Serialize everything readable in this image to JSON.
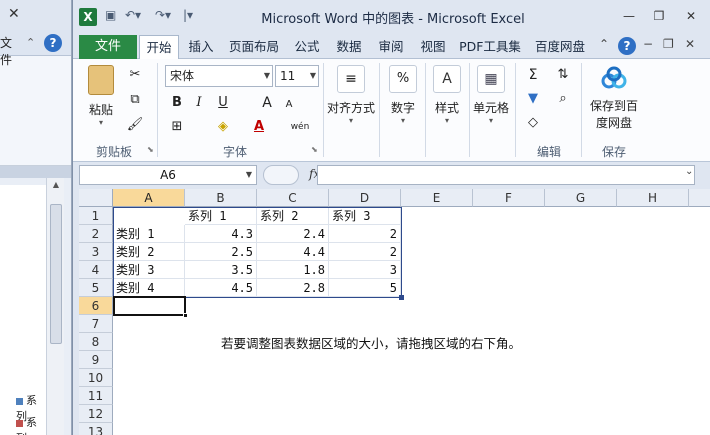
{
  "background_window": {
    "file_tab": "文件",
    "legend": [
      {
        "label": "系列",
        "color": "#4f81bd"
      },
      {
        "label": "系列",
        "color": "#c0504d"
      }
    ]
  },
  "window": {
    "title": "Microsoft Word 中的图表 - Microsoft Excel",
    "app_icon": "X"
  },
  "tabs": {
    "file": "文件",
    "items": [
      "开始",
      "插入",
      "页面布局",
      "公式",
      "数据",
      "审阅",
      "视图",
      "PDF工具集",
      "百度网盘"
    ],
    "active": "开始"
  },
  "ribbon": {
    "clipboard": {
      "paste": "粘贴",
      "group": "剪贴板"
    },
    "font": {
      "name": "宋体",
      "size": "11",
      "group": "字体",
      "bold": "B",
      "italic": "I",
      "underline": "U",
      "grow": "A",
      "shrink": "A",
      "color_a": "A",
      "phonetic": "wén"
    },
    "align": {
      "label": "对齐方式"
    },
    "number": {
      "label": "数字",
      "icon_text": "%"
    },
    "styles": {
      "label": "样式"
    },
    "cells": {
      "label": "单元格"
    },
    "editing": {
      "group": "编辑",
      "sum": "Σ"
    },
    "save": {
      "label": "保存到百度网盘",
      "line1": "保存到百",
      "line2": "度网盘",
      "group": "保存"
    }
  },
  "formula_bar": {
    "name_box": "A6",
    "fx": "fx",
    "value": ""
  },
  "sheet": {
    "columns": [
      "A",
      "B",
      "C",
      "D",
      "E",
      "F",
      "G",
      "H"
    ],
    "rows": [
      "1",
      "2",
      "3",
      "4",
      "5",
      "6",
      "7",
      "8",
      "9",
      "10",
      "11",
      "12",
      "13"
    ],
    "header_row": [
      "",
      "系列 1",
      "系列 2",
      "系列 3"
    ],
    "data": [
      {
        "label": "类别 1",
        "values": [
          "4.3",
          "2.4",
          "2"
        ]
      },
      {
        "label": "类别 2",
        "values": [
          "2.5",
          "4.4",
          "2"
        ]
      },
      {
        "label": "类别 3",
        "values": [
          "3.5",
          "1.8",
          "3"
        ]
      },
      {
        "label": "类别 4",
        "values": [
          "4.5",
          "2.8",
          "5"
        ]
      }
    ],
    "note": "若要调整图表数据区域的大小，请拖拽区域的右下角。",
    "active_cell": "A6"
  }
}
